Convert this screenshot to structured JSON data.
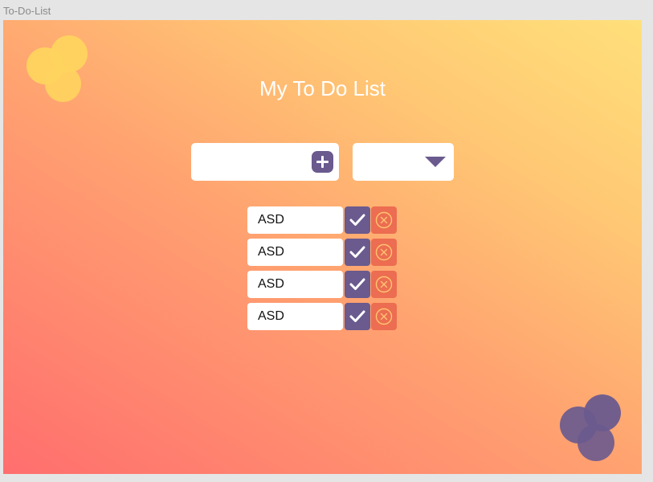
{
  "window": {
    "title": "To-Do-List"
  },
  "header": {
    "title": "My To Do List"
  },
  "add_form": {
    "input_value": "",
    "add_icon": "plus-icon"
  },
  "filter": {
    "selected": "",
    "icon": "triangle-down-icon"
  },
  "todos": [
    {
      "text": "ASD",
      "check_icon": "check-icon",
      "delete_icon": "close-circle-icon"
    },
    {
      "text": "ASD",
      "check_icon": "check-icon",
      "delete_icon": "close-circle-icon"
    },
    {
      "text": "ASD",
      "check_icon": "check-icon",
      "delete_icon": "close-circle-icon"
    },
    {
      "text": "ASD",
      "check_icon": "check-icon",
      "delete_icon": "close-circle-icon"
    }
  ],
  "colors": {
    "accent_purple": "#6a5a8e",
    "delete_orange": "#ec6d51",
    "blob_yellow": "#ffd45e",
    "gradient_start": "#ff6e6e",
    "gradient_end": "#ffe07a"
  }
}
